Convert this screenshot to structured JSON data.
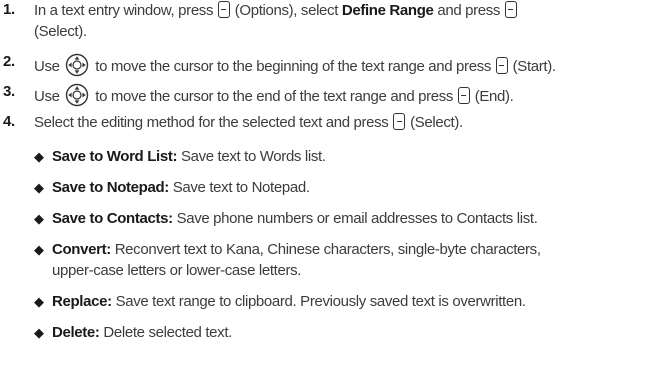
{
  "steps": [
    {
      "num": "1.",
      "l1_a": "In a text entry window, press",
      "l1_b": "(Options), select",
      "l1_bold": "Define Range",
      "l1_c": "and press",
      "l2": "(Select)."
    },
    {
      "num": "2.",
      "a": "Use",
      "b": "to move the cursor to the beginning of the text range and press",
      "c": "(Start)."
    },
    {
      "num": "3.",
      "a": "Use",
      "b": "to move the cursor to the end of the text range and press",
      "c": "(End)."
    },
    {
      "num": "4.",
      "a": "Select the editing method for the selected text and press",
      "b": "(Select)."
    }
  ],
  "bullets": [
    {
      "term": "Save to Word List:",
      "text": "Save text to Words list."
    },
    {
      "term": "Save to Notepad:",
      "text": "Save text to Notepad."
    },
    {
      "term": "Save to Contacts:",
      "text": "Save phone numbers or email addresses to Contacts list."
    },
    {
      "term": "Convert:",
      "text": "Reconvert text to Kana, Chinese characters, single-byte characters,",
      "text2": "upper-case letters or lower-case letters."
    },
    {
      "term": "Replace:",
      "text": "Save text range to clipboard. Previously saved text is overwritten."
    },
    {
      "term": "Delete:",
      "text": "Delete selected text."
    }
  ],
  "icons": {
    "softkey": "softkey-icon",
    "navigation": "navigation-key-icon",
    "bullet": "diamond-bullet-icon"
  }
}
